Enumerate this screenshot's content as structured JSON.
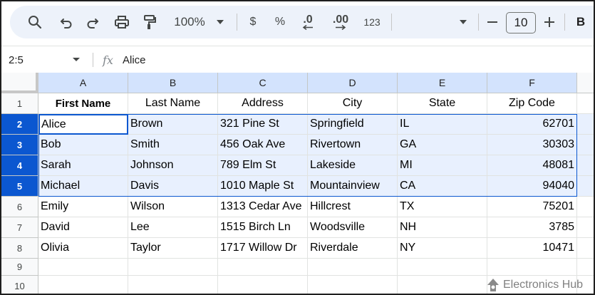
{
  "toolbar": {
    "zoom": "100%",
    "currency_label": "$",
    "percent_label": "%",
    "decrease_decimal_label": ".0",
    "increase_decimal_label": ".00",
    "number_format_label": "123",
    "font_size": "10",
    "bold_label": "B"
  },
  "formula_bar": {
    "name_box": "2:5",
    "fx_label": "fx",
    "value": "Alice"
  },
  "columns": [
    "A",
    "B",
    "C",
    "D",
    "E",
    "F"
  ],
  "rows": [
    "1",
    "2",
    "3",
    "4",
    "5",
    "6",
    "7",
    "8",
    "9",
    "10"
  ],
  "table": {
    "headers": [
      "First Name",
      "Last Name",
      "Address",
      "City",
      "State",
      "Zip Code"
    ],
    "data": [
      [
        "Alice",
        "Brown",
        "321 Pine St",
        "Springfield",
        "IL",
        "62701"
      ],
      [
        "Bob",
        "Smith",
        "456 Oak Ave",
        "Rivertown",
        "GA",
        "30303"
      ],
      [
        "Sarah",
        "Johnson",
        "789 Elm St",
        "Lakeside",
        "MI",
        "48081"
      ],
      [
        "Michael",
        "Davis",
        "1010 Maple St",
        "Mountainview",
        "CA",
        "94040"
      ],
      [
        "Emily",
        "Wilson",
        "1313 Cedar Ave",
        "Hillcrest",
        "TX",
        "75201"
      ],
      [
        "David",
        "Lee",
        "1515 Birch Ln",
        "Woodsville",
        "NH",
        "3785"
      ],
      [
        "Olivia",
        "Taylor",
        "1717 Willow Dr",
        "Riverdale",
        "NY",
        "10471"
      ]
    ]
  },
  "selection": {
    "active_cell_value": "Alice"
  },
  "watermark": {
    "text": "Electronics Hub"
  },
  "colors": {
    "selected_row_header": "#0b57d0",
    "selected_range_fill": "#e8f0fe",
    "column_header_selected": "#d3e3fd",
    "toolbar_bg": "#edf2fa"
  },
  "icons": [
    "search-icon",
    "undo-icon",
    "redo-icon",
    "print-icon",
    "paint-format-icon",
    "zoom-dropdown-icon",
    "font-size-minus-icon",
    "font-size-plus-icon",
    "fx-icon",
    "name-box-dropdown-icon",
    "electronics-hub-logo-icon"
  ]
}
